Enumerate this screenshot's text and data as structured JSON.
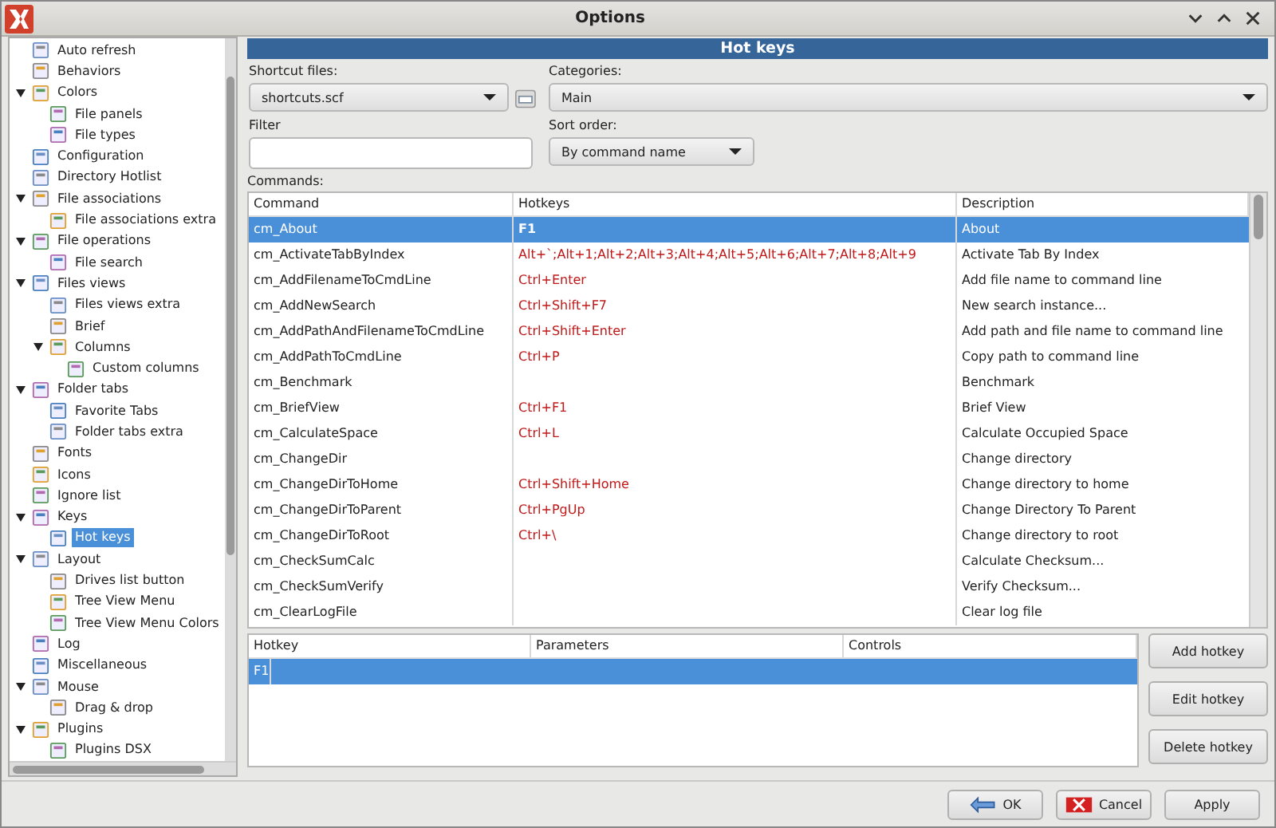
{
  "window": {
    "title": "Options"
  },
  "tree": [
    {
      "label": "Auto refresh",
      "selected": false
    },
    {
      "label": "Behaviors",
      "selected": false
    },
    {
      "label": "Colors",
      "selected": false,
      "expanded": true,
      "children": [
        {
          "label": "File panels",
          "selected": false
        },
        {
          "label": "File types",
          "selected": false
        }
      ]
    },
    {
      "label": "Configuration",
      "selected": false
    },
    {
      "label": "Directory Hotlist",
      "selected": false
    },
    {
      "label": "File associations",
      "selected": false,
      "expanded": true,
      "children": [
        {
          "label": "File associations extra",
          "selected": false
        }
      ]
    },
    {
      "label": "File operations",
      "selected": false,
      "expanded": true,
      "children": [
        {
          "label": "File search",
          "selected": false
        }
      ]
    },
    {
      "label": "Files views",
      "selected": false,
      "expanded": true,
      "children": [
        {
          "label": "Files views extra",
          "selected": false
        },
        {
          "label": "Brief",
          "selected": false
        },
        {
          "label": "Columns",
          "selected": false,
          "expanded": true,
          "children": [
            {
              "label": "Custom columns",
              "selected": false
            }
          ]
        }
      ]
    },
    {
      "label": "Folder tabs",
      "selected": false,
      "expanded": true,
      "children": [
        {
          "label": "Favorite Tabs",
          "selected": false
        },
        {
          "label": "Folder tabs extra",
          "selected": false
        }
      ]
    },
    {
      "label": "Fonts",
      "selected": false
    },
    {
      "label": "Icons",
      "selected": false
    },
    {
      "label": "Ignore list",
      "selected": false
    },
    {
      "label": "Keys",
      "selected": false,
      "expanded": true,
      "children": [
        {
          "label": "Hot keys",
          "selected": true
        }
      ]
    },
    {
      "label": "Layout",
      "selected": false,
      "expanded": true,
      "children": [
        {
          "label": "Drives list button",
          "selected": false
        },
        {
          "label": "Tree View Menu",
          "selected": false
        },
        {
          "label": "Tree View Menu Colors",
          "selected": false
        }
      ]
    },
    {
      "label": "Log",
      "selected": false
    },
    {
      "label": "Miscellaneous",
      "selected": false
    },
    {
      "label": "Mouse",
      "selected": false,
      "expanded": true,
      "children": [
        {
          "label": "Drag & drop",
          "selected": false
        }
      ]
    },
    {
      "label": "Plugins",
      "selected": false,
      "expanded": true,
      "children": [
        {
          "label": "Plugins DSX",
          "selected": false
        }
      ]
    }
  ],
  "panel": {
    "title": "Hot keys"
  },
  "shortcut_files": {
    "label": "Shortcut files:",
    "value": "shortcuts.scf"
  },
  "categories": {
    "label": "Categories:",
    "value": "Main"
  },
  "filter": {
    "label": "Filter"
  },
  "sort_order": {
    "label": "Sort order:",
    "value": "By command name"
  },
  "commands": {
    "label": "Commands:",
    "columns": [
      "Command",
      "Hotkeys",
      "Description"
    ],
    "rows": [
      {
        "command": "cm_About",
        "hotkeys": "F1",
        "description": "About",
        "selected": true
      },
      {
        "command": "cm_ActivateTabByIndex",
        "hotkeys": "Alt+`;Alt+1;Alt+2;Alt+3;Alt+4;Alt+5;Alt+6;Alt+7;Alt+8;Alt+9",
        "description": "Activate Tab By Index",
        "selected": false
      },
      {
        "command": "cm_AddFilenameToCmdLine",
        "hotkeys": "Ctrl+Enter",
        "description": "Add file name to command line",
        "selected": false
      },
      {
        "command": "cm_AddNewSearch",
        "hotkeys": "Ctrl+Shift+F7",
        "description": "New search instance...",
        "selected": false
      },
      {
        "command": "cm_AddPathAndFilenameToCmdLine",
        "hotkeys": "Ctrl+Shift+Enter",
        "description": "Add path and file name to command line",
        "selected": false
      },
      {
        "command": "cm_AddPathToCmdLine",
        "hotkeys": "Ctrl+P",
        "description": "Copy path to command line",
        "selected": false
      },
      {
        "command": "cm_Benchmark",
        "description": "Benchmark",
        "selected": false
      },
      {
        "command": "cm_BriefView",
        "hotkeys": "Ctrl+F1",
        "description": "Brief View",
        "selected": false
      },
      {
        "command": "cm_CalculateSpace",
        "hotkeys": "Ctrl+L",
        "description": "Calculate Occupied Space",
        "selected": false
      },
      {
        "command": "cm_ChangeDir",
        "description": "Change directory",
        "selected": false
      },
      {
        "command": "cm_ChangeDirToHome",
        "hotkeys": "Ctrl+Shift+Home",
        "description": "Change directory to home",
        "selected": false
      },
      {
        "command": "cm_ChangeDirToParent",
        "hotkeys": "Ctrl+PgUp",
        "description": "Change Directory To Parent",
        "selected": false
      },
      {
        "command": "cm_ChangeDirToRoot",
        "hotkeys": "Ctrl+\\",
        "description": "Change directory to root",
        "selected": false
      },
      {
        "command": "cm_CheckSumCalc",
        "description": "Calculate Checksum...",
        "selected": false
      },
      {
        "command": "cm_CheckSumVerify",
        "description": "Verify Checksum...",
        "selected": false
      },
      {
        "command": "cm_ClearLogFile",
        "description": "Clear log file",
        "selected": false
      }
    ]
  },
  "hotkeys_table": {
    "columns": [
      "Hotkey",
      "Parameters",
      "Controls"
    ],
    "rows": [
      {
        "hotkey": "F1",
        "selected": true
      }
    ]
  },
  "hotkey_buttons": [
    "Add hotkey",
    "Edit hotkey",
    "Delete hotkey"
  ],
  "dialog_buttons": [
    {
      "label": "OK",
      "kind": "ok"
    },
    {
      "label": "Cancel",
      "kind": "cancel"
    },
    {
      "label": "Apply",
      "kind": "plain"
    }
  ]
}
